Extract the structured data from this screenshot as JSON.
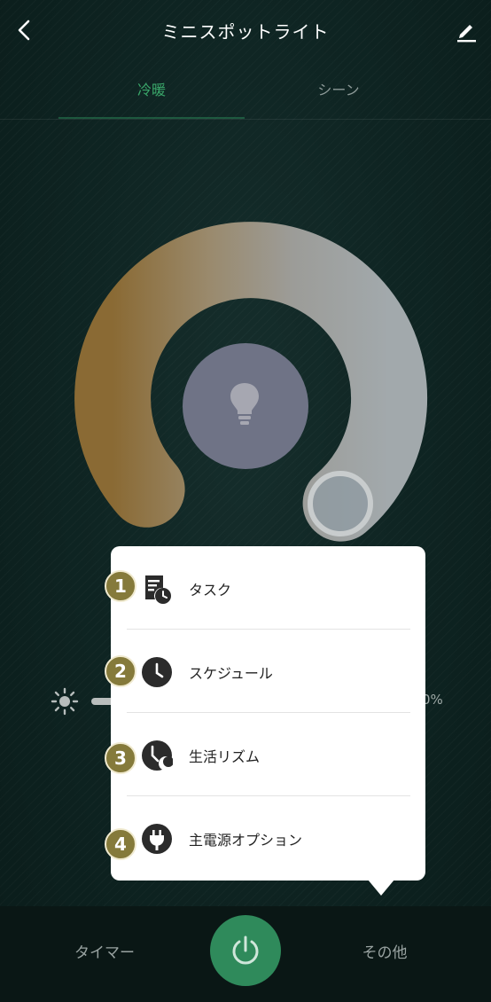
{
  "header": {
    "title": "ミニスポットライト",
    "back_icon": "chevron-left-icon",
    "edit_icon": "pencil-icon"
  },
  "tabs": [
    {
      "label": "冷暖",
      "active": true
    },
    {
      "label": "シーン",
      "active": false
    }
  ],
  "dial": {
    "center_icon": "lightbulb-icon",
    "warm_color": "#8a6a34",
    "cool_color": "#a2a9ac"
  },
  "brightness": {
    "icon": "sun-icon",
    "value_text": "0%"
  },
  "menu": {
    "items": [
      {
        "badge": "1",
        "label": "タスク",
        "icon": "task-clock-icon"
      },
      {
        "badge": "2",
        "label": "スケジュール",
        "icon": "clock-icon"
      },
      {
        "badge": "3",
        "label": "生活リズム",
        "icon": "sun-moon-icon"
      },
      {
        "badge": "4",
        "label": "主電源オプション",
        "icon": "plug-icon"
      }
    ]
  },
  "bottom": {
    "timer_label": "タイマー",
    "power_icon": "power-icon",
    "more_label": "その他"
  },
  "colors": {
    "accent": "#2f8a5b",
    "tab_active": "#3aa76a",
    "badge": "#857a3b"
  }
}
